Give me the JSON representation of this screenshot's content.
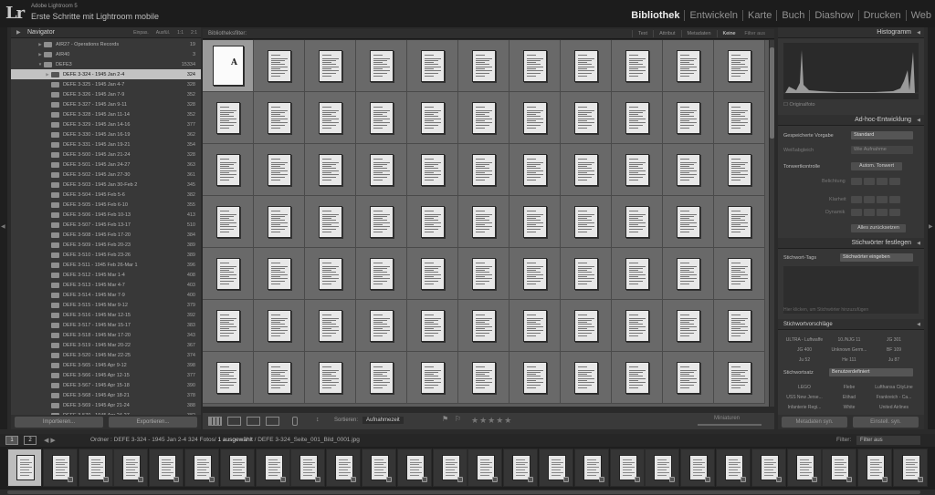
{
  "identity": {
    "logo": "Lr",
    "app_version": "Adobe Lightroom 5",
    "catalog_title": "Erste Schritte mit Lightroom mobile"
  },
  "modules": [
    "Bibliothek",
    "Entwickeln",
    "Karte",
    "Buch",
    "Diashow",
    "Drucken",
    "Web"
  ],
  "active_module": "Bibliothek",
  "navigator": {
    "title": "Navigator",
    "zoom": [
      "Einpas.",
      "Ausfül.",
      "1:1",
      "2:1"
    ]
  },
  "folders": [
    {
      "label": "AIR27 - Operations Records",
      "count": "19",
      "kind": "folder"
    },
    {
      "label": "AIR40",
      "count": "3",
      "kind": "folder"
    },
    {
      "label": "DEFE3",
      "count": "15334",
      "kind": "folder-open"
    },
    {
      "label": "DEFE 3-324 - 1945 Jan 2-4",
      "count": "324",
      "kind": "selected"
    },
    {
      "label": "DEFE 3-325 - 1945 Jan 4-7",
      "count": "328"
    },
    {
      "label": "DEFE 3-326 - 1945 Jan 7-9",
      "count": "352"
    },
    {
      "label": "DEFE 3-327 - 1945 Jan 9-11",
      "count": "328"
    },
    {
      "label": "DEFE 3-328 - 1945 Jan 11-14",
      "count": "352"
    },
    {
      "label": "DEFE 3-329 - 1945 Jan 14-16",
      "count": "377"
    },
    {
      "label": "DEFE 3-330 - 1945 Jan 16-19",
      "count": "362"
    },
    {
      "label": "DEFE 3-331 - 1945 Jan 19-21",
      "count": "354"
    },
    {
      "label": "DEFE 3-500 - 1945 Jan 21-24",
      "count": "328"
    },
    {
      "label": "DEFE 3-501 - 1945 Jan 24-27",
      "count": "363"
    },
    {
      "label": "DEFE 3-502 - 1945 Jan 27-30",
      "count": "361"
    },
    {
      "label": "DEFE 3-503 - 1945 Jan 30-Feb 2",
      "count": "345"
    },
    {
      "label": "DEFE 3-504 - 1945 Feb 5-6",
      "count": "382"
    },
    {
      "label": "DEFE 3-505 - 1945 Feb 6-10",
      "count": "355"
    },
    {
      "label": "DEFE 3-506 - 1945 Feb 10-13",
      "count": "413"
    },
    {
      "label": "DEFE 3-507 - 1945 Feb 13-17",
      "count": "510"
    },
    {
      "label": "DEFE 3-508 - 1945 Feb 17-20",
      "count": "384"
    },
    {
      "label": "DEFE 3-509 - 1945 Feb 20-23",
      "count": "389"
    },
    {
      "label": "DEFE 3-510 - 1945 Feb 23-26",
      "count": "389"
    },
    {
      "label": "DEFE 3-511 - 1945 Feb 26-Mar 1",
      "count": "396"
    },
    {
      "label": "DEFE 3-512 - 1945 Mar 1-4",
      "count": "408"
    },
    {
      "label": "DEFE 3-513 - 1945 Mar 4-7",
      "count": "403"
    },
    {
      "label": "DEFE 3-514 - 1945 Mar 7-9",
      "count": "400"
    },
    {
      "label": "DEFE 3-515 - 1945 Mar 9-12",
      "count": "379"
    },
    {
      "label": "DEFE 3-516 - 1945 Mar 12-15",
      "count": "392"
    },
    {
      "label": "DEFE 3-517 - 1945 Mar 15-17",
      "count": "383"
    },
    {
      "label": "DEFE 3-518 - 1945 Mar 17-20",
      "count": "343"
    },
    {
      "label": "DEFE 3-519 - 1945 Mar 20-22",
      "count": "367"
    },
    {
      "label": "DEFE 3-520 - 1945 Mar 22-25",
      "count": "374"
    },
    {
      "label": "DEFE 3-565 - 1945 Apr 9-12",
      "count": "398"
    },
    {
      "label": "DEFE 3-566 - 1945 Apr 12-15",
      "count": "377"
    },
    {
      "label": "DEFE 3-567 - 1945 Apr 15-18",
      "count": "390"
    },
    {
      "label": "DEFE 3-568 - 1945 Apr 18-21",
      "count": "378"
    },
    {
      "label": "DEFE 3-569 - 1945 Apr 21-24",
      "count": "388"
    },
    {
      "label": "DEFE 3-570 - 1945 Apr 24-27",
      "count": "382"
    }
  ],
  "left_buttons": {
    "import": "Importieren...",
    "export": "Exportieren..."
  },
  "filter_bar": {
    "title": "Bibliotheksfilter:",
    "tabs": [
      "Text",
      "Attribut",
      "Metadaten",
      "Keine"
    ],
    "active_tab": "Keine",
    "presets": "Filter aus"
  },
  "grid": {
    "columns": 11,
    "rows": 7,
    "selected_index": 0,
    "first_doc_mark": "A"
  },
  "toolbar": {
    "sort_label": "Sortieren:",
    "sort_value": "Aufnahmezeit",
    "rating": "★★★★★",
    "thumb_label": "Miniaturen"
  },
  "right_panel": {
    "histogram_title": "Histogramm",
    "original_photo": "Originalfoto",
    "quick_develop_title": "Ad-hoc-Entwicklung",
    "saved_preset_label": "Gespeicherte Vorgabe",
    "saved_preset_value": "Standard",
    "white_balance_label": "Weißabgleich",
    "white_balance_value": "Wie Aufnahme",
    "tone_control_label": "Tonwertkontrolle",
    "auto_tone": "Autom. Tonwert",
    "exposure_label": "Belichtung",
    "clarity_label": "Klarheit",
    "vibrance_label": "Dynamik",
    "reset_all": "Alles zurücksetzen",
    "keywording_title": "Stichwörter festlegen",
    "keyword_tags_label": "Stichwort-Tags",
    "keyword_tags_value": "Stichwörter eingeben",
    "keyword_hint": "Hier klicken, um Stichwörter hinzuzufügen",
    "suggestions_title": "Stichwortvorschläge",
    "suggestions": [
      "ULTRA - Luftwaffe",
      "10./NJG 11",
      "JG 301",
      "JG 400",
      "Unknown Germ...",
      "BF 109",
      "Ju 52",
      "He 111",
      "Ju 87"
    ],
    "keyword_set_label": "Stichwortsatz",
    "keyword_set_value": "Benutzerdefiniert",
    "keyword_set": [
      "LEGO",
      "Flebe",
      "Lufthansa CityLine",
      "USS New Jerse...",
      "Etihad",
      "Frankreich - Ca...",
      "Infanterie Regi...",
      "White",
      "United Airlines"
    ]
  },
  "right_buttons": {
    "sync_metadata": "Metadaten syn.",
    "sync_settings": "Einstell. syn."
  },
  "filmstrip_bar": {
    "monitor1": "1",
    "monitor2": "2",
    "nav": "◀ ▶",
    "path_prefix": "Ordner : DEFE 3-324 - 1945 Jan 2-4",
    "path_count": "324 Fotos",
    "path_selected": "1 ausgewählt",
    "path_file": "/ DEFE 3-324_Seite_001_Bild_0001.jpg",
    "filter_label": "Filter:",
    "filter_value": "Filter aus"
  }
}
